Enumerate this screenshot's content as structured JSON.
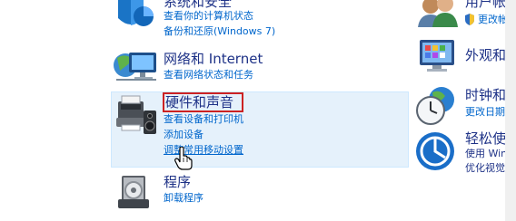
{
  "left_column": {
    "system": {
      "title": "系统和安全",
      "links": [
        "查看你的计算机状态",
        "备份和还原(Windows 7)"
      ]
    },
    "network": {
      "title": "网络和 Internet",
      "links": [
        "查看网络状态和任务"
      ]
    },
    "hardware": {
      "title": "硬件和声音",
      "links": [
        "查看设备和打印机",
        "添加设备",
        "调整常用移动设置"
      ]
    },
    "programs": {
      "title": "程序",
      "links": [
        "卸载程序"
      ]
    }
  },
  "right_column": {
    "user": {
      "title": "用户帐户",
      "links": [
        "更改帐户"
      ]
    },
    "appearance": {
      "title": "外观和个"
    },
    "clock": {
      "title": "时钟和区",
      "links": [
        "更改日期、"
      ]
    },
    "ease": {
      "title": "轻松使用",
      "links": [
        "使用 Wind",
        "优化视觉显"
      ]
    }
  }
}
